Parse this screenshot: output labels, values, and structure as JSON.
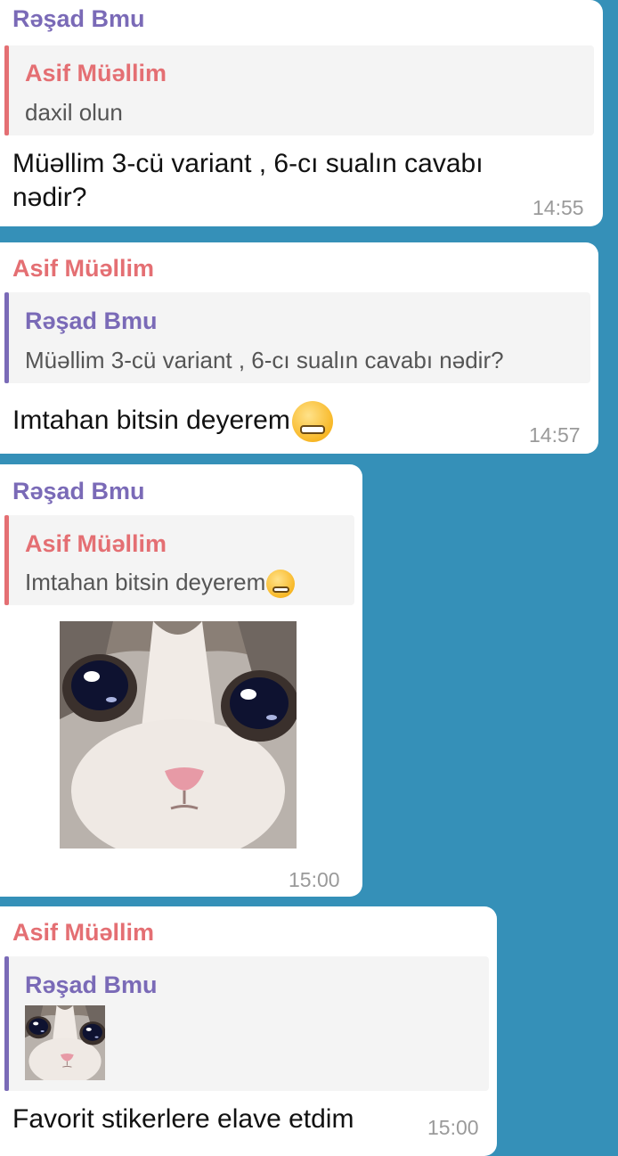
{
  "colors": {
    "background": "#3590b8",
    "bubble": "#ffffff",
    "name_purple": "#7a6ab7",
    "name_red": "#e46f73",
    "quote_bg": "#f4f4f4",
    "timestamp": "#9a9a9a"
  },
  "messages": [
    {
      "sender": "Rəşad Bmu",
      "reply_to": {
        "name": "Asif Müəllim",
        "text": "daxil olun"
      },
      "text_line1": "Müəllim 3-cü variant , 6-cı sualın cavabı",
      "text_line2": "nədir?",
      "time": "14:55"
    },
    {
      "sender": "Asif Müəllim",
      "reply_to": {
        "name": "Rəşad Bmu",
        "text": "Müəllim 3-cü variant , 6-cı sualın cavabı nədir?"
      },
      "text": "Imtahan bitsin deyerem",
      "emoji": "zipper-mouth-face-icon",
      "time": "14:57"
    },
    {
      "sender": "Rəşad Bmu",
      "reply_to": {
        "name": "Asif Müəllim",
        "text": "Imtahan bitsin deyerem",
        "emoji": "zipper-mouth-face-icon"
      },
      "sticker": "crying-cat-sticker",
      "time": "15:00"
    },
    {
      "sender": "Asif Müəllim",
      "reply_to": {
        "name": "Rəşad Bmu",
        "sticker": "crying-cat-sticker-thumbnail"
      },
      "text": "Favorit stikerlere elave etdim",
      "time": "15:00"
    }
  ]
}
